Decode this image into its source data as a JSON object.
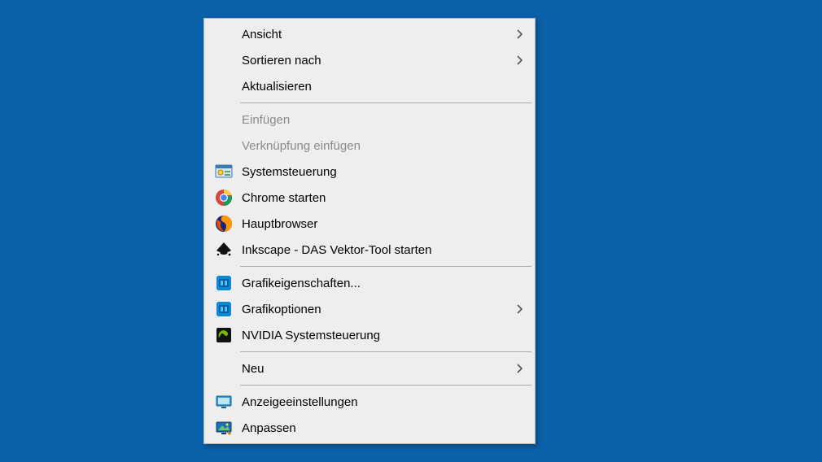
{
  "menu": {
    "items": [
      {
        "label": "Ansicht",
        "submenu": true,
        "enabled": true,
        "icon": null
      },
      {
        "label": "Sortieren nach",
        "submenu": true,
        "enabled": true,
        "icon": null
      },
      {
        "label": "Aktualisieren",
        "submenu": false,
        "enabled": true,
        "icon": null
      },
      {
        "type": "separator"
      },
      {
        "label": "Einfügen",
        "submenu": false,
        "enabled": false,
        "icon": null
      },
      {
        "label": "Verknüpfung einfügen",
        "submenu": false,
        "enabled": false,
        "icon": null
      },
      {
        "label": "Systemsteuerung",
        "submenu": false,
        "enabled": true,
        "icon": "control-panel"
      },
      {
        "label": "Chrome starten",
        "submenu": false,
        "enabled": true,
        "icon": "chrome"
      },
      {
        "label": "Hauptbrowser",
        "submenu": false,
        "enabled": true,
        "icon": "firefox"
      },
      {
        "label": "Inkscape - DAS Vektor-Tool starten",
        "submenu": false,
        "enabled": true,
        "icon": "inkscape"
      },
      {
        "type": "separator"
      },
      {
        "label": "Grafikeigenschaften...",
        "submenu": false,
        "enabled": true,
        "icon": "intel-gfx"
      },
      {
        "label": "Grafikoptionen",
        "submenu": true,
        "enabled": true,
        "icon": "intel-gfx"
      },
      {
        "label": "NVIDIA Systemsteuerung",
        "submenu": false,
        "enabled": true,
        "icon": "nvidia"
      },
      {
        "type": "separator"
      },
      {
        "label": "Neu",
        "submenu": true,
        "enabled": true,
        "icon": null
      },
      {
        "type": "separator"
      },
      {
        "label": "Anzeigeeinstellungen",
        "submenu": false,
        "enabled": true,
        "icon": "display-settings"
      },
      {
        "label": "Anpassen",
        "submenu": false,
        "enabled": true,
        "icon": "personalize"
      }
    ]
  }
}
